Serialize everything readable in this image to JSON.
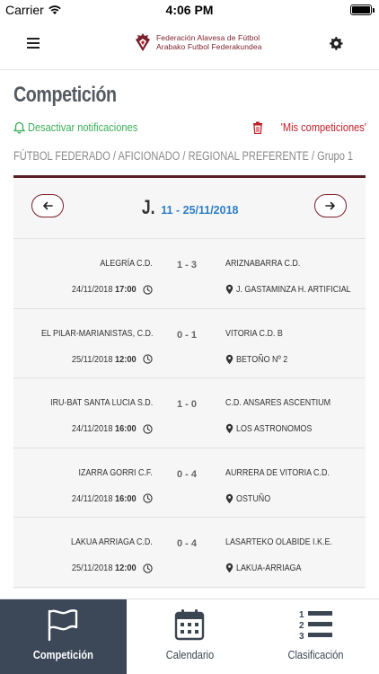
{
  "status_bar": {
    "carrier": "Carrier",
    "time": "4:06 PM",
    "battery_level": 1.0
  },
  "header": {
    "brand_line1": "Federación Alavesa de Fútbol",
    "brand_line2": "Arabako Futbol Federakundea"
  },
  "page_title": "Competición",
  "actions": {
    "notifications": "Desactivar notificaciones",
    "my_competitions": "'Mis competiciones'"
  },
  "breadcrumb": "FÚTBOL FEDERADO / AFICIONADO / REGIONAL PREFERENTE / Grupo 1",
  "round": {
    "prefix": "J.",
    "range": "11 - 25/11/2018"
  },
  "matches": [
    {
      "home": "ALEGRÍA C.D.",
      "score": "1 - 3",
      "away": "ARIZNABARRA C.D.",
      "date": "24/11/2018",
      "time": "17:00",
      "venue": "J. GASTAMINZA H. ARTIFICIAL"
    },
    {
      "home": "EL PILAR-MARIANISTAS, C.D.",
      "score": "0 - 1",
      "away": "VITORIA C.D. B",
      "date": "25/11/2018",
      "time": "12:00",
      "venue": "BETOÑO Nº 2"
    },
    {
      "home": "IRU-BAT SANTA LUCIA S.D.",
      "score": "1 - 0",
      "away": "C.D. ANSARES ASCENTIUM",
      "date": "24/11/2018",
      "time": "16:00",
      "venue": "LOS ASTRONOMOS"
    },
    {
      "home": "IZARRA GORRI C.F.",
      "score": "0 - 4",
      "away": "AURRERA DE VITORIA C.D.",
      "date": "24/11/2018",
      "time": "16:00",
      "venue": "OSTUÑO"
    },
    {
      "home": "LAKUA ARRIAGA C.D.",
      "score": "0 - 4",
      "away": "LASARTEKO OLABIDE I.K.E.",
      "date": "25/11/2018",
      "time": "12:00",
      "venue": "LAKUA-ARRIAGA"
    }
  ],
  "tabs": [
    {
      "label": "Competición",
      "icon": "flag-icon",
      "active": true
    },
    {
      "label": "Calendario",
      "icon": "calendar-icon",
      "active": false
    },
    {
      "label": "Clasificación",
      "icon": "ranking-list-icon",
      "active": false
    }
  ],
  "colors": {
    "brand": "#7a1f2b",
    "accent_green": "#3aae57",
    "accent_red": "#c0202b",
    "link_blue": "#2e7fc4",
    "tab_active_bg": "#3c4858"
  }
}
